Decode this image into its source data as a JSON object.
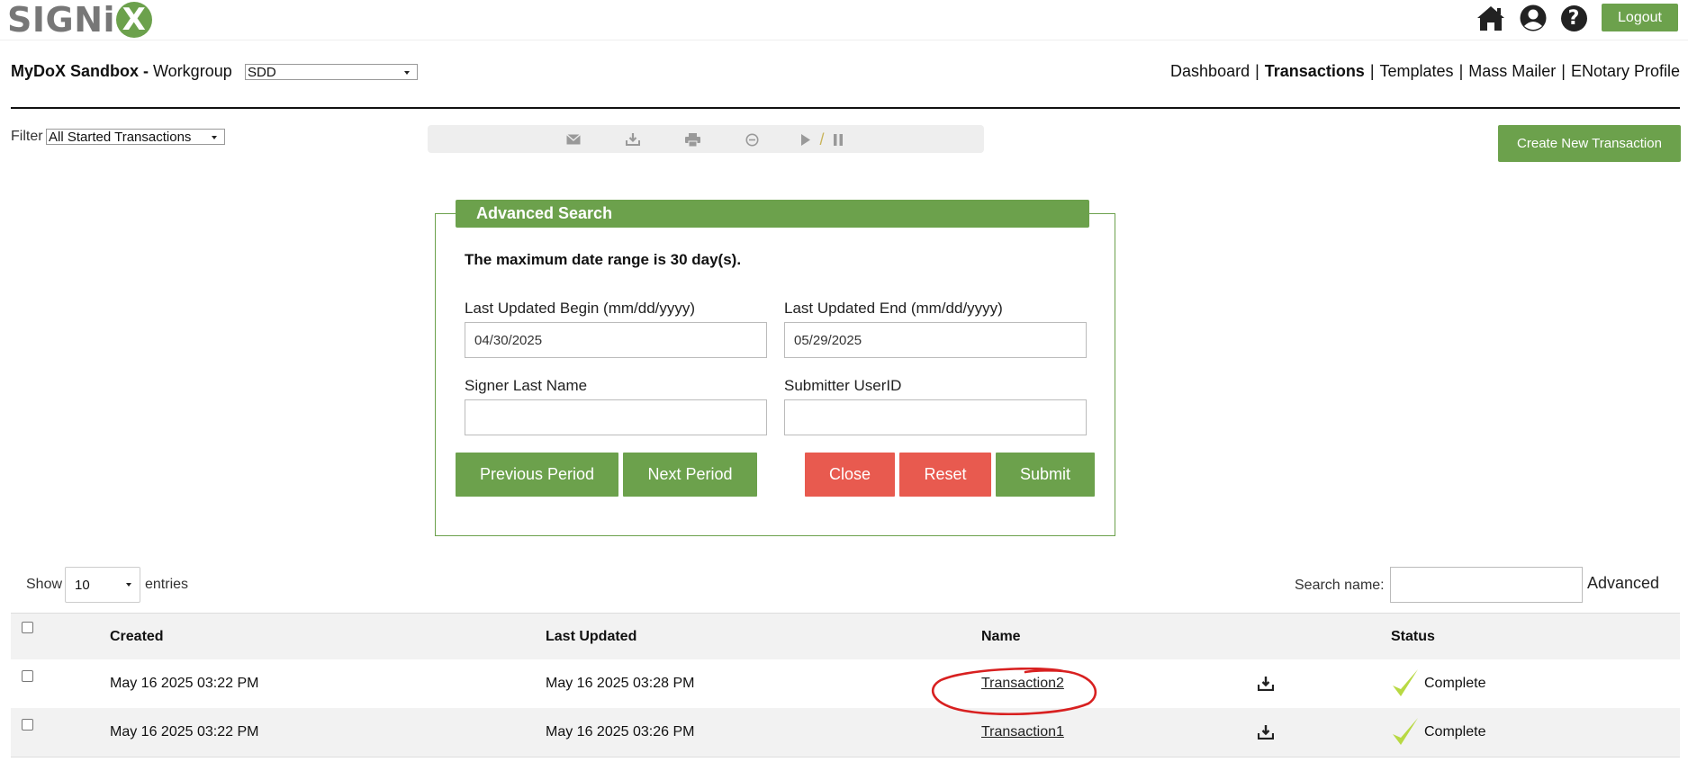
{
  "header": {
    "logo_text": "SIGNi",
    "logo_x": "X",
    "logout_label": "Logout",
    "icons": [
      "home-icon",
      "account-icon",
      "help-icon"
    ]
  },
  "account": {
    "name": "MyDoX Sandbox",
    "dash": " - ",
    "workgroup_label": "Workgroup",
    "workgroup_value": "SDD"
  },
  "nav": {
    "items": [
      {
        "label": "Dashboard",
        "active": false
      },
      {
        "label": "Transactions",
        "active": true
      },
      {
        "label": "Templates",
        "active": false
      },
      {
        "label": "Mass Mailer",
        "active": false
      },
      {
        "label": "ENotary Profile",
        "active": false
      }
    ],
    "separator": "|"
  },
  "filter": {
    "label": "Filter",
    "value": "All Started Transactions"
  },
  "toolbar": {
    "icons": [
      "email-icon",
      "download-icon",
      "print-icon",
      "cancel-icon",
      "play-icon",
      "pause-icon"
    ],
    "slash": "/"
  },
  "create_button": "Create New Transaction",
  "advanced_search": {
    "title": "Advanced Search",
    "max_range": "The maximum date range is 30 day(s).",
    "begin_label": "Last Updated Begin (mm/dd/yyyy)",
    "begin_value": "04/30/2025",
    "end_label": "Last Updated End (mm/dd/yyyy)",
    "end_value": "05/29/2025",
    "signer_label": "Signer Last Name",
    "signer_value": "",
    "submitter_label": "Submitter UserID",
    "submitter_value": "",
    "buttons": {
      "previous": "Previous Period",
      "next": "Next Period",
      "close": "Close",
      "reset": "Reset",
      "submit": "Submit"
    },
    "colors": {
      "green": "#6ca14c",
      "red": "#e85a4f"
    }
  },
  "table_controls": {
    "show_label": "Show",
    "length_value": "10",
    "entries_label": "entries",
    "search_label": "Search name:",
    "search_value": "",
    "advanced_label": "Advanced"
  },
  "table": {
    "columns": [
      "Created",
      "Last Updated",
      "Name",
      "Status"
    ],
    "rows": [
      {
        "created": "May 16 2025 03:22 PM",
        "updated": "May 16 2025 03:28 PM",
        "name": "Transaction2",
        "status": "Complete",
        "circled": true
      },
      {
        "created": "May 16 2025 03:22 PM",
        "updated": "May 16 2025 03:26 PM",
        "name": "Transaction1",
        "status": "Complete",
        "circled": false
      }
    ]
  }
}
